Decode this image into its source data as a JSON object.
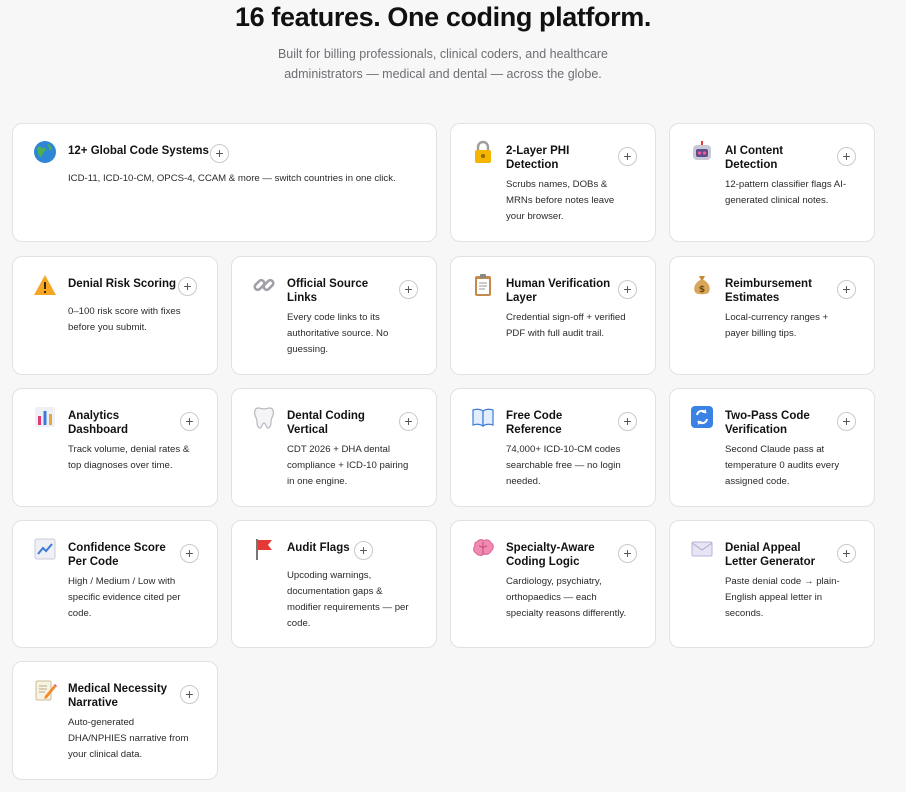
{
  "hero": {
    "title": "16 features. One coding platform.",
    "subtitle_line1": "Built for billing professionals, clinical coders, and healthcare",
    "subtitle_line2": "administrators — medical and dental — across the globe."
  },
  "features": [
    {
      "icon": "globe-icon",
      "title_lines": [
        "12+ Global Code Systems"
      ],
      "desc_lines": [
        "ICD-11, ICD-10-CM, OPCS-4, CCAM & more — switch countries in one click."
      ]
    },
    {
      "icon": "lock-icon",
      "title_lines": [
        "2-Layer PHI",
        "Detection"
      ],
      "desc_lines": [
        "Scrubs names, DOBs &",
        "MRNs before notes leave",
        "your browser."
      ]
    },
    {
      "icon": "robot-icon",
      "title_lines": [
        "AI Content",
        "Detection"
      ],
      "desc_lines": [
        "12-pattern classifier flags AI-",
        "generated clinical notes."
      ]
    },
    {
      "icon": "warning-icon",
      "title_lines": [
        "Denial Risk Scoring"
      ],
      "desc_lines": [
        "0–100 risk score with fixes",
        "before you submit."
      ]
    },
    {
      "icon": "link-icon",
      "title_lines": [
        "Official Source",
        "Links"
      ],
      "desc_lines": [
        "Every code links to its",
        "authoritative source. No",
        "guessing."
      ]
    },
    {
      "icon": "clipboard-icon",
      "title_lines": [
        "Human Verification",
        "Layer"
      ],
      "desc_lines": [
        "Credential sign-off + verified",
        "PDF with full audit trail."
      ]
    },
    {
      "icon": "money-bag-icon",
      "title_lines": [
        "Reimbursement",
        "Estimates"
      ],
      "desc_lines": [
        "Local-currency ranges +",
        "payer billing tips."
      ]
    },
    {
      "icon": "bar-chart-icon",
      "title_lines": [
        "Analytics",
        "Dashboard"
      ],
      "desc_lines": [
        "Track volume, denial rates &",
        "top diagnoses over time."
      ]
    },
    {
      "icon": "tooth-icon",
      "title_lines": [
        "Dental Coding",
        "Vertical"
      ],
      "desc_lines": [
        "CDT 2026 + DHA dental",
        "compliance + ICD-10 pairing",
        "in one engine."
      ]
    },
    {
      "icon": "book-icon",
      "title_lines": [
        "Free Code",
        "Reference"
      ],
      "desc_lines": [
        "74,000+ ICD-10-CM codes",
        "searchable free — no login",
        "needed."
      ]
    },
    {
      "icon": "repeat-icon",
      "title_lines": [
        "Two-Pass Code",
        "Verification"
      ],
      "desc_lines": [
        "Second Claude pass at",
        "temperature 0 audits every",
        "assigned code."
      ]
    },
    {
      "icon": "trend-chart-icon",
      "title_lines": [
        "Confidence Score",
        "Per Code"
      ],
      "desc_lines": [
        "High / Medium / Low with",
        "specific evidence cited per",
        "code."
      ]
    },
    {
      "icon": "red-flag-icon",
      "title_lines": [
        "Audit Flags"
      ],
      "desc_lines": [
        "Upcoding warnings,",
        "documentation gaps &",
        "modifier requirements — per",
        "code."
      ]
    },
    {
      "icon": "brain-icon",
      "title_lines": [
        "Specialty-Aware",
        "Coding Logic"
      ],
      "desc_lines": [
        "Cardiology, psychiatry,",
        "orthopaedics — each",
        "specialty reasons differently."
      ]
    },
    {
      "icon": "envelope-icon",
      "title_lines": [
        "Denial Appeal",
        "Letter Generator"
      ],
      "desc_lines": [
        "Paste denial code → plain-",
        "English appeal letter in",
        "seconds."
      ]
    },
    {
      "icon": "memo-icon",
      "title_lines": [
        "Medical Necessity",
        "Narrative"
      ],
      "desc_lines": [
        "Auto-generated",
        "DHA/NPHIES narrative from",
        "your clinical data."
      ]
    }
  ],
  "colors": {
    "background": "#f7f7f8",
    "card": "#ffffff",
    "card_border": "#e2e2e6"
  }
}
